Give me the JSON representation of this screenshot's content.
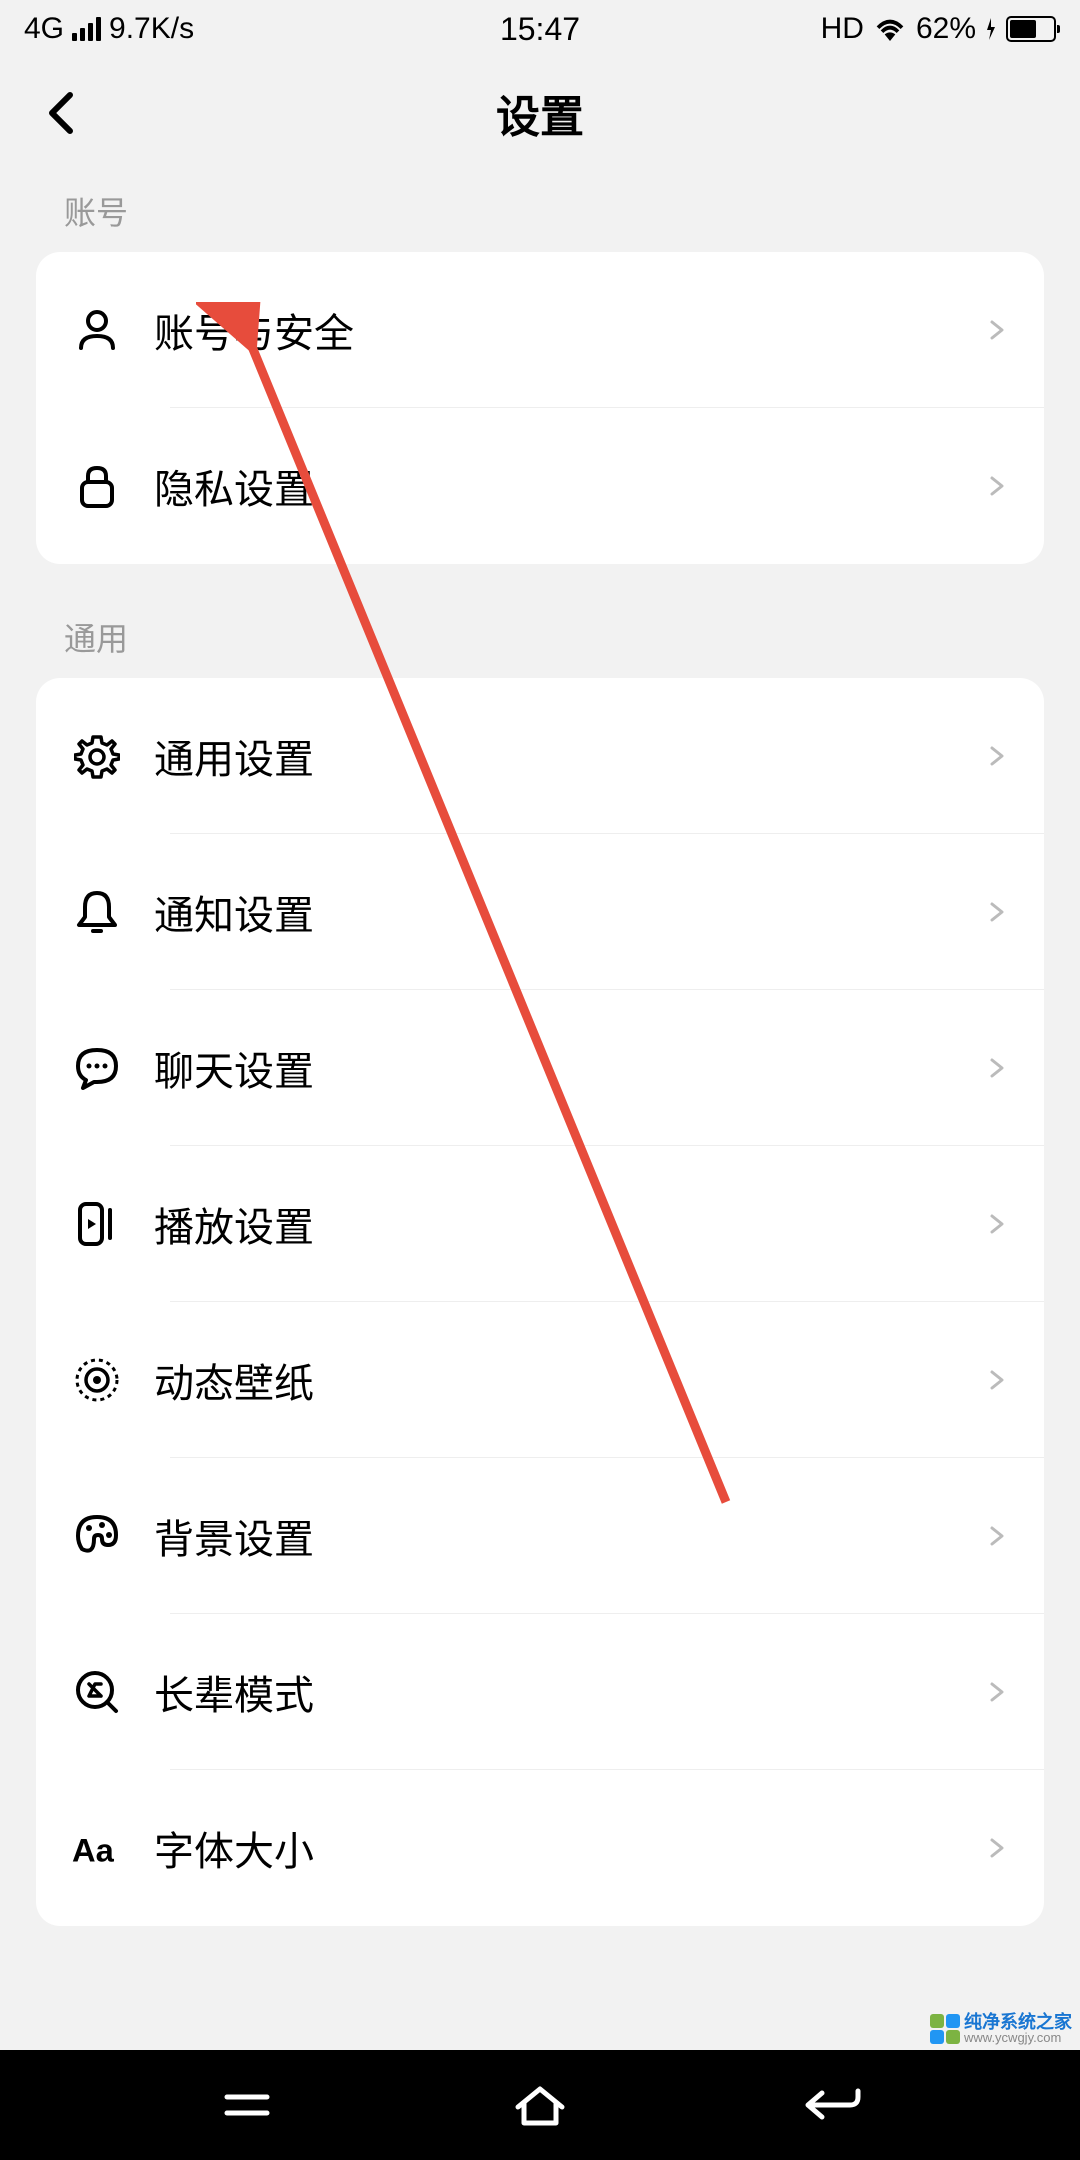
{
  "status_bar": {
    "network_type": "4G",
    "data_speed": "9.7K/s",
    "time": "15:47",
    "hd": "HD",
    "battery_percent": "62%"
  },
  "header": {
    "title": "设置"
  },
  "sections": {
    "account": {
      "label": "账号",
      "items": [
        {
          "label": "账号与安全"
        },
        {
          "label": "隐私设置"
        }
      ]
    },
    "general": {
      "label": "通用",
      "items": [
        {
          "label": "通用设置"
        },
        {
          "label": "通知设置"
        },
        {
          "label": "聊天设置"
        },
        {
          "label": "播放设置"
        },
        {
          "label": "动态壁纸"
        },
        {
          "label": "背景设置"
        },
        {
          "label": "长辈模式"
        },
        {
          "label": "字体大小"
        }
      ]
    }
  },
  "watermark": {
    "text1": "纯净系统之家",
    "text2": "www.ycwgjy.com"
  }
}
